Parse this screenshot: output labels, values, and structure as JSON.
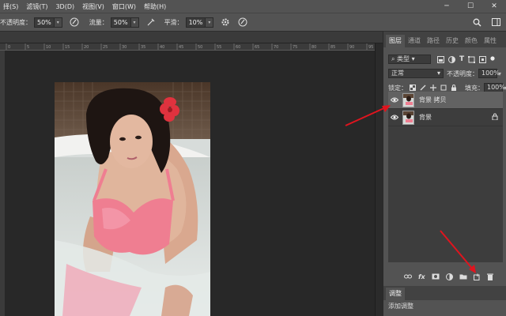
{
  "menubar": {
    "items": [
      "择(S)",
      "滤镜(T)",
      "3D(D)",
      "视图(V)",
      "窗口(W)",
      "帮助(H)"
    ],
    "window_controls": [
      "─",
      "☐",
      "✕"
    ]
  },
  "options_bar": {
    "opacity_label": "不透明度：",
    "opacity_value": "50%",
    "flow_label": "流量：",
    "flow_value": "50%",
    "smooth_label": "平滑：",
    "smooth_value": "10%"
  },
  "ruler": {
    "ticks": [
      "0",
      "5",
      "10",
      "15",
      "20",
      "25",
      "30",
      "35",
      "40",
      "45",
      "50",
      "55",
      "60",
      "65",
      "70",
      "75",
      "80",
      "85",
      "90",
      "95"
    ]
  },
  "panel": {
    "tabs": [
      "图层",
      "通道",
      "路径",
      "历史",
      "颜色",
      "属性"
    ],
    "filter_kind": "类型",
    "blend_mode": "正常",
    "opacity_label": "不透明度：",
    "opacity_value": "100%",
    "lock_label": "锁定：",
    "fill_label": "填充：",
    "fill_value": "100%",
    "layers": [
      {
        "name": "背景 拷贝",
        "selected": true,
        "locked": false
      },
      {
        "name": "背景",
        "selected": false,
        "locked": true
      }
    ],
    "footer_icons": [
      "link-icon",
      "fx-icon",
      "mask-icon",
      "adjustment-icon",
      "folder-icon",
      "new-layer-icon",
      "trash-icon"
    ]
  },
  "adjust_panel": {
    "tab": "调整",
    "body": "添加调整"
  },
  "colors": {
    "accent_arrow": "#e0141e",
    "panel_bg": "#535353",
    "canvas_bg": "#282828"
  }
}
